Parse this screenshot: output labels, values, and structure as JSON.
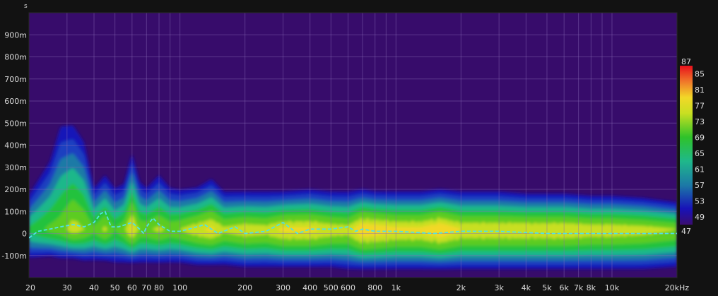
{
  "chart_data": {
    "type": "heatmap",
    "title": "",
    "xlabel": "",
    "ylabel": "s",
    "x_scale": "log",
    "xlim": [
      20,
      20000
    ],
    "ylim": [
      -0.2,
      1.0
    ],
    "x_ticks": [
      {
        "value": 20,
        "label": "20"
      },
      {
        "value": 30,
        "label": "30"
      },
      {
        "value": 40,
        "label": "40"
      },
      {
        "value": 50,
        "label": "50"
      },
      {
        "value": 60,
        "label": "60"
      },
      {
        "value": 70,
        "label": "70"
      },
      {
        "value": 80,
        "label": "80"
      },
      {
        "value": 100,
        "label": "100"
      },
      {
        "value": 200,
        "label": "200"
      },
      {
        "value": 300,
        "label": "300"
      },
      {
        "value": 400,
        "label": "400"
      },
      {
        "value": 500,
        "label": "500"
      },
      {
        "value": 600,
        "label": "600"
      },
      {
        "value": 800,
        "label": "800"
      },
      {
        "value": 1000,
        "label": "1k"
      },
      {
        "value": 2000,
        "label": "2k"
      },
      {
        "value": 3000,
        "label": "3k"
      },
      {
        "value": 4000,
        "label": "4k"
      },
      {
        "value": 5000,
        "label": "5k"
      },
      {
        "value": 6000,
        "label": "6k"
      },
      {
        "value": 7000,
        "label": "7k"
      },
      {
        "value": 8000,
        "label": "8k"
      },
      {
        "value": 10000,
        "label": "10k"
      },
      {
        "value": 20000,
        "label": "20kHz"
      }
    ],
    "x_minor_ticks": [
      90,
      700,
      900,
      9000
    ],
    "y_ticks": [
      {
        "value": 0.9,
        "label": "900m"
      },
      {
        "value": 0.8,
        "label": "800m"
      },
      {
        "value": 0.7,
        "label": "700m"
      },
      {
        "value": 0.6,
        "label": "600m"
      },
      {
        "value": 0.5,
        "label": "500m"
      },
      {
        "value": 0.4,
        "label": "400m"
      },
      {
        "value": 0.3,
        "label": "300m"
      },
      {
        "value": 0.2,
        "label": "200m"
      },
      {
        "value": 0.1,
        "label": "100m"
      },
      {
        "value": 0.0,
        "label": "0"
      },
      {
        "value": -0.1,
        "label": "-100m"
      }
    ],
    "grid": true,
    "colorbar": {
      "min": 47,
      "max": 87,
      "top_label": "87",
      "bottom_label": "47",
      "ticks": [
        {
          "value": 85,
          "label": "85"
        },
        {
          "value": 81,
          "label": "81"
        },
        {
          "value": 77,
          "label": "77"
        },
        {
          "value": 73,
          "label": "73"
        },
        {
          "value": 69,
          "label": "69"
        },
        {
          "value": 65,
          "label": "65"
        },
        {
          "value": 61,
          "label": "61"
        },
        {
          "value": 57,
          "label": "57"
        },
        {
          "value": 53,
          "label": "53"
        },
        {
          "value": 49,
          "label": "49"
        }
      ]
    },
    "regions": [
      {
        "f": 20,
        "top": 0.19,
        "bottom": -0.12,
        "level": 66
      },
      {
        "f": 25,
        "top": 0.35,
        "bottom": -0.11,
        "level": 70
      },
      {
        "f": 28,
        "top": 0.52,
        "bottom": -0.12,
        "level": 71
      },
      {
        "f": 32,
        "top": 0.52,
        "bottom": -0.12,
        "level": 75
      },
      {
        "f": 36,
        "top": 0.44,
        "bottom": -0.13,
        "level": 73
      },
      {
        "f": 40,
        "top": 0.22,
        "bottom": -0.13,
        "level": 70
      },
      {
        "f": 45,
        "top": 0.28,
        "bottom": -0.13,
        "level": 74
      },
      {
        "f": 50,
        "top": 0.22,
        "bottom": -0.14,
        "level": 69
      },
      {
        "f": 55,
        "top": 0.24,
        "bottom": -0.14,
        "level": 72
      },
      {
        "f": 60,
        "top": 0.38,
        "bottom": -0.14,
        "level": 78
      },
      {
        "f": 65,
        "top": 0.25,
        "bottom": -0.14,
        "level": 72
      },
      {
        "f": 70,
        "top": 0.22,
        "bottom": -0.14,
        "level": 72
      },
      {
        "f": 80,
        "top": 0.28,
        "bottom": -0.14,
        "level": 74
      },
      {
        "f": 90,
        "top": 0.22,
        "bottom": -0.14,
        "level": 72
      },
      {
        "f": 100,
        "top": 0.21,
        "bottom": -0.14,
        "level": 73
      },
      {
        "f": 120,
        "top": 0.22,
        "bottom": -0.15,
        "level": 76
      },
      {
        "f": 140,
        "top": 0.26,
        "bottom": -0.15,
        "level": 78
      },
      {
        "f": 160,
        "top": 0.2,
        "bottom": -0.15,
        "level": 74
      },
      {
        "f": 200,
        "top": 0.2,
        "bottom": -0.16,
        "level": 76
      },
      {
        "f": 250,
        "top": 0.2,
        "bottom": -0.16,
        "level": 75
      },
      {
        "f": 300,
        "top": 0.2,
        "bottom": -0.16,
        "level": 78
      },
      {
        "f": 400,
        "top": 0.21,
        "bottom": -0.16,
        "level": 78
      },
      {
        "f": 500,
        "top": 0.2,
        "bottom": -0.16,
        "level": 76
      },
      {
        "f": 600,
        "top": 0.2,
        "bottom": -0.17,
        "level": 75
      },
      {
        "f": 700,
        "top": 0.21,
        "bottom": -0.17,
        "level": 81
      },
      {
        "f": 800,
        "top": 0.2,
        "bottom": -0.17,
        "level": 80
      },
      {
        "f": 1000,
        "top": 0.2,
        "bottom": -0.17,
        "level": 78
      },
      {
        "f": 1300,
        "top": 0.2,
        "bottom": -0.17,
        "level": 78
      },
      {
        "f": 1600,
        "top": 0.21,
        "bottom": -0.17,
        "level": 81
      },
      {
        "f": 2000,
        "top": 0.2,
        "bottom": -0.17,
        "level": 77
      },
      {
        "f": 3000,
        "top": 0.2,
        "bottom": -0.17,
        "level": 77
      },
      {
        "f": 4000,
        "top": 0.19,
        "bottom": -0.17,
        "level": 77
      },
      {
        "f": 5000,
        "top": 0.19,
        "bottom": -0.17,
        "level": 77
      },
      {
        "f": 6000,
        "top": 0.19,
        "bottom": -0.17,
        "level": 77
      },
      {
        "f": 8000,
        "top": 0.18,
        "bottom": -0.17,
        "level": 76
      },
      {
        "f": 10000,
        "top": 0.18,
        "bottom": -0.17,
        "level": 76
      },
      {
        "f": 14000,
        "top": 0.17,
        "bottom": -0.17,
        "level": 75
      },
      {
        "f": 20000,
        "top": 0.15,
        "bottom": -0.16,
        "level": 73
      }
    ],
    "series": [
      {
        "x": [
          20,
          22,
          25,
          28,
          32,
          36,
          40,
          43,
          45,
          48,
          52,
          56,
          60,
          65,
          68,
          70,
          75,
          80,
          90,
          100,
          110,
          130,
          150,
          180,
          200,
          250,
          300,
          350,
          400,
          500,
          600,
          650,
          700,
          800,
          1000,
          1500,
          2000,
          3000,
          5000,
          10000,
          20000
        ],
        "values": [
          -0.02,
          0.01,
          0.02,
          0.03,
          0.04,
          0.03,
          0.05,
          0.09,
          0.1,
          0.03,
          0.03,
          0.04,
          0.05,
          0.02,
          0.0,
          0.03,
          0.07,
          0.04,
          0.01,
          0.01,
          0.02,
          0.04,
          0.0,
          0.03,
          0.0,
          0.01,
          0.05,
          0.0,
          0.02,
          0.02,
          0.03,
          0.01,
          0.02,
          0.01,
          0.01,
          0.0,
          0.01,
          0.01,
          0.0,
          0.0,
          0.0
        ]
      }
    ]
  }
}
